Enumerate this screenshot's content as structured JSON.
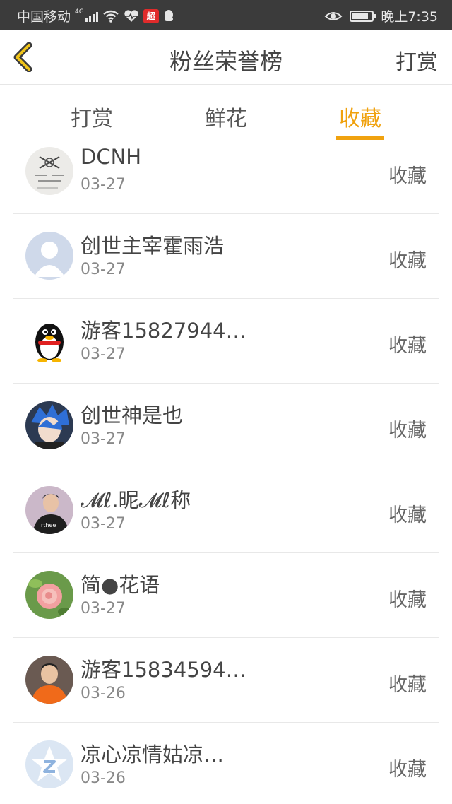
{
  "status_bar": {
    "carrier": "中国移动",
    "network": "4G",
    "app_badge": "超",
    "time": "晚上7:35"
  },
  "header": {
    "title": "粉丝荣誉榜",
    "action": "打赏"
  },
  "tabs": [
    {
      "label": "打赏",
      "active": false
    },
    {
      "label": "鲜花",
      "active": false
    },
    {
      "label": "收藏",
      "active": true
    }
  ],
  "accent_color": "#f0a20f",
  "rows": [
    {
      "name": "DCNH",
      "date": "03-27",
      "tag": "收藏",
      "avatar": "sketch-avatar"
    },
    {
      "name": "创世主宰霍雨浩",
      "date": "03-27",
      "tag": "收藏",
      "avatar": "default-person-avatar"
    },
    {
      "name": "游客15827944…",
      "date": "03-27",
      "tag": "收藏",
      "avatar": "qq-penguin-avatar"
    },
    {
      "name": "创世神是也",
      "date": "03-27",
      "tag": "收藏",
      "avatar": "anime-avatar"
    },
    {
      "name": "𝓜ℓ.昵𝓜ℓ称",
      "date": "03-27",
      "tag": "收藏",
      "avatar": "person-photo-avatar"
    },
    {
      "name": "简●花语",
      "date": "03-27",
      "tag": "收藏",
      "avatar": "flower-avatar"
    },
    {
      "name": "游客15834594…",
      "date": "03-26",
      "tag": "收藏",
      "avatar": "person-orange-avatar"
    },
    {
      "name": "凉心凉情姑凉…",
      "date": "03-26",
      "tag": "收藏",
      "avatar": "star-z-avatar"
    }
  ]
}
